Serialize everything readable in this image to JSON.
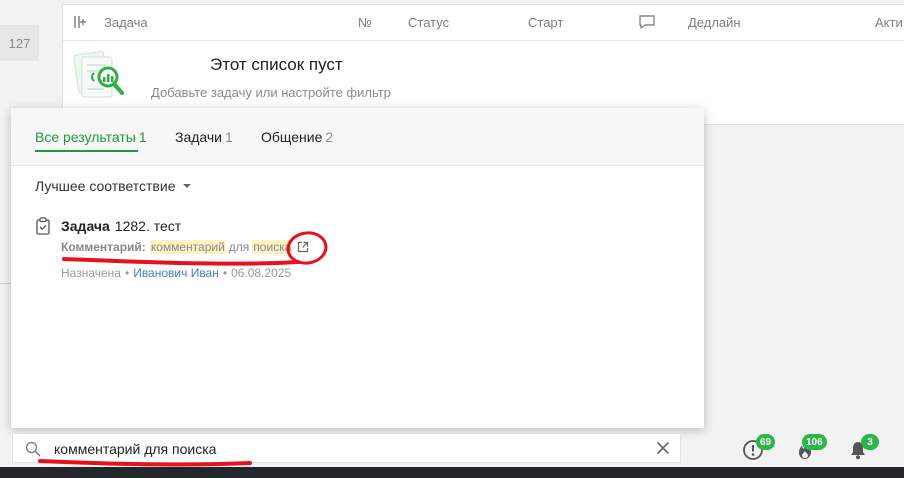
{
  "sidebar": {
    "count": "127"
  },
  "table": {
    "columns": {
      "task": "Задача",
      "number": "№",
      "status": "Статус",
      "start": "Старт",
      "deadline": "Дедлайн",
      "activity": "Акти"
    },
    "empty_title": "Этот список пуст",
    "empty_subtitle": "Добавьте задачу или настройте фильтр"
  },
  "search_results": {
    "tabs": [
      {
        "label": "Все результаты",
        "count": "1"
      },
      {
        "label": "Задачи",
        "count": "1"
      },
      {
        "label": "Общение",
        "count": "2"
      }
    ],
    "sort_label": "Лучшее соответствие",
    "results": [
      {
        "type_label": "Задача",
        "title": "1282. тест",
        "comment_label": "Комментарий:",
        "comment_highlight_1": "комментарий",
        "comment_plain": "для",
        "comment_highlight_2": "поиска",
        "meta_status": "Назначена",
        "meta_user": "Иванович Иван",
        "meta_date": "06.08.2025",
        "separator": "•"
      }
    ]
  },
  "search": {
    "value": "комментарий для поиска"
  },
  "notifications": {
    "alerts": {
      "icon": "alert-icon",
      "count": "69"
    },
    "fire": {
      "icon": "fire-icon",
      "count": "106"
    },
    "bell": {
      "icon": "bell-icon",
      "count": "3"
    }
  },
  "colors": {
    "accent": "#1e9b3a",
    "badge": "#2bb54b",
    "link": "#3a7fc4",
    "highlight": "#fff3c2",
    "annotation": "#e8101c"
  }
}
